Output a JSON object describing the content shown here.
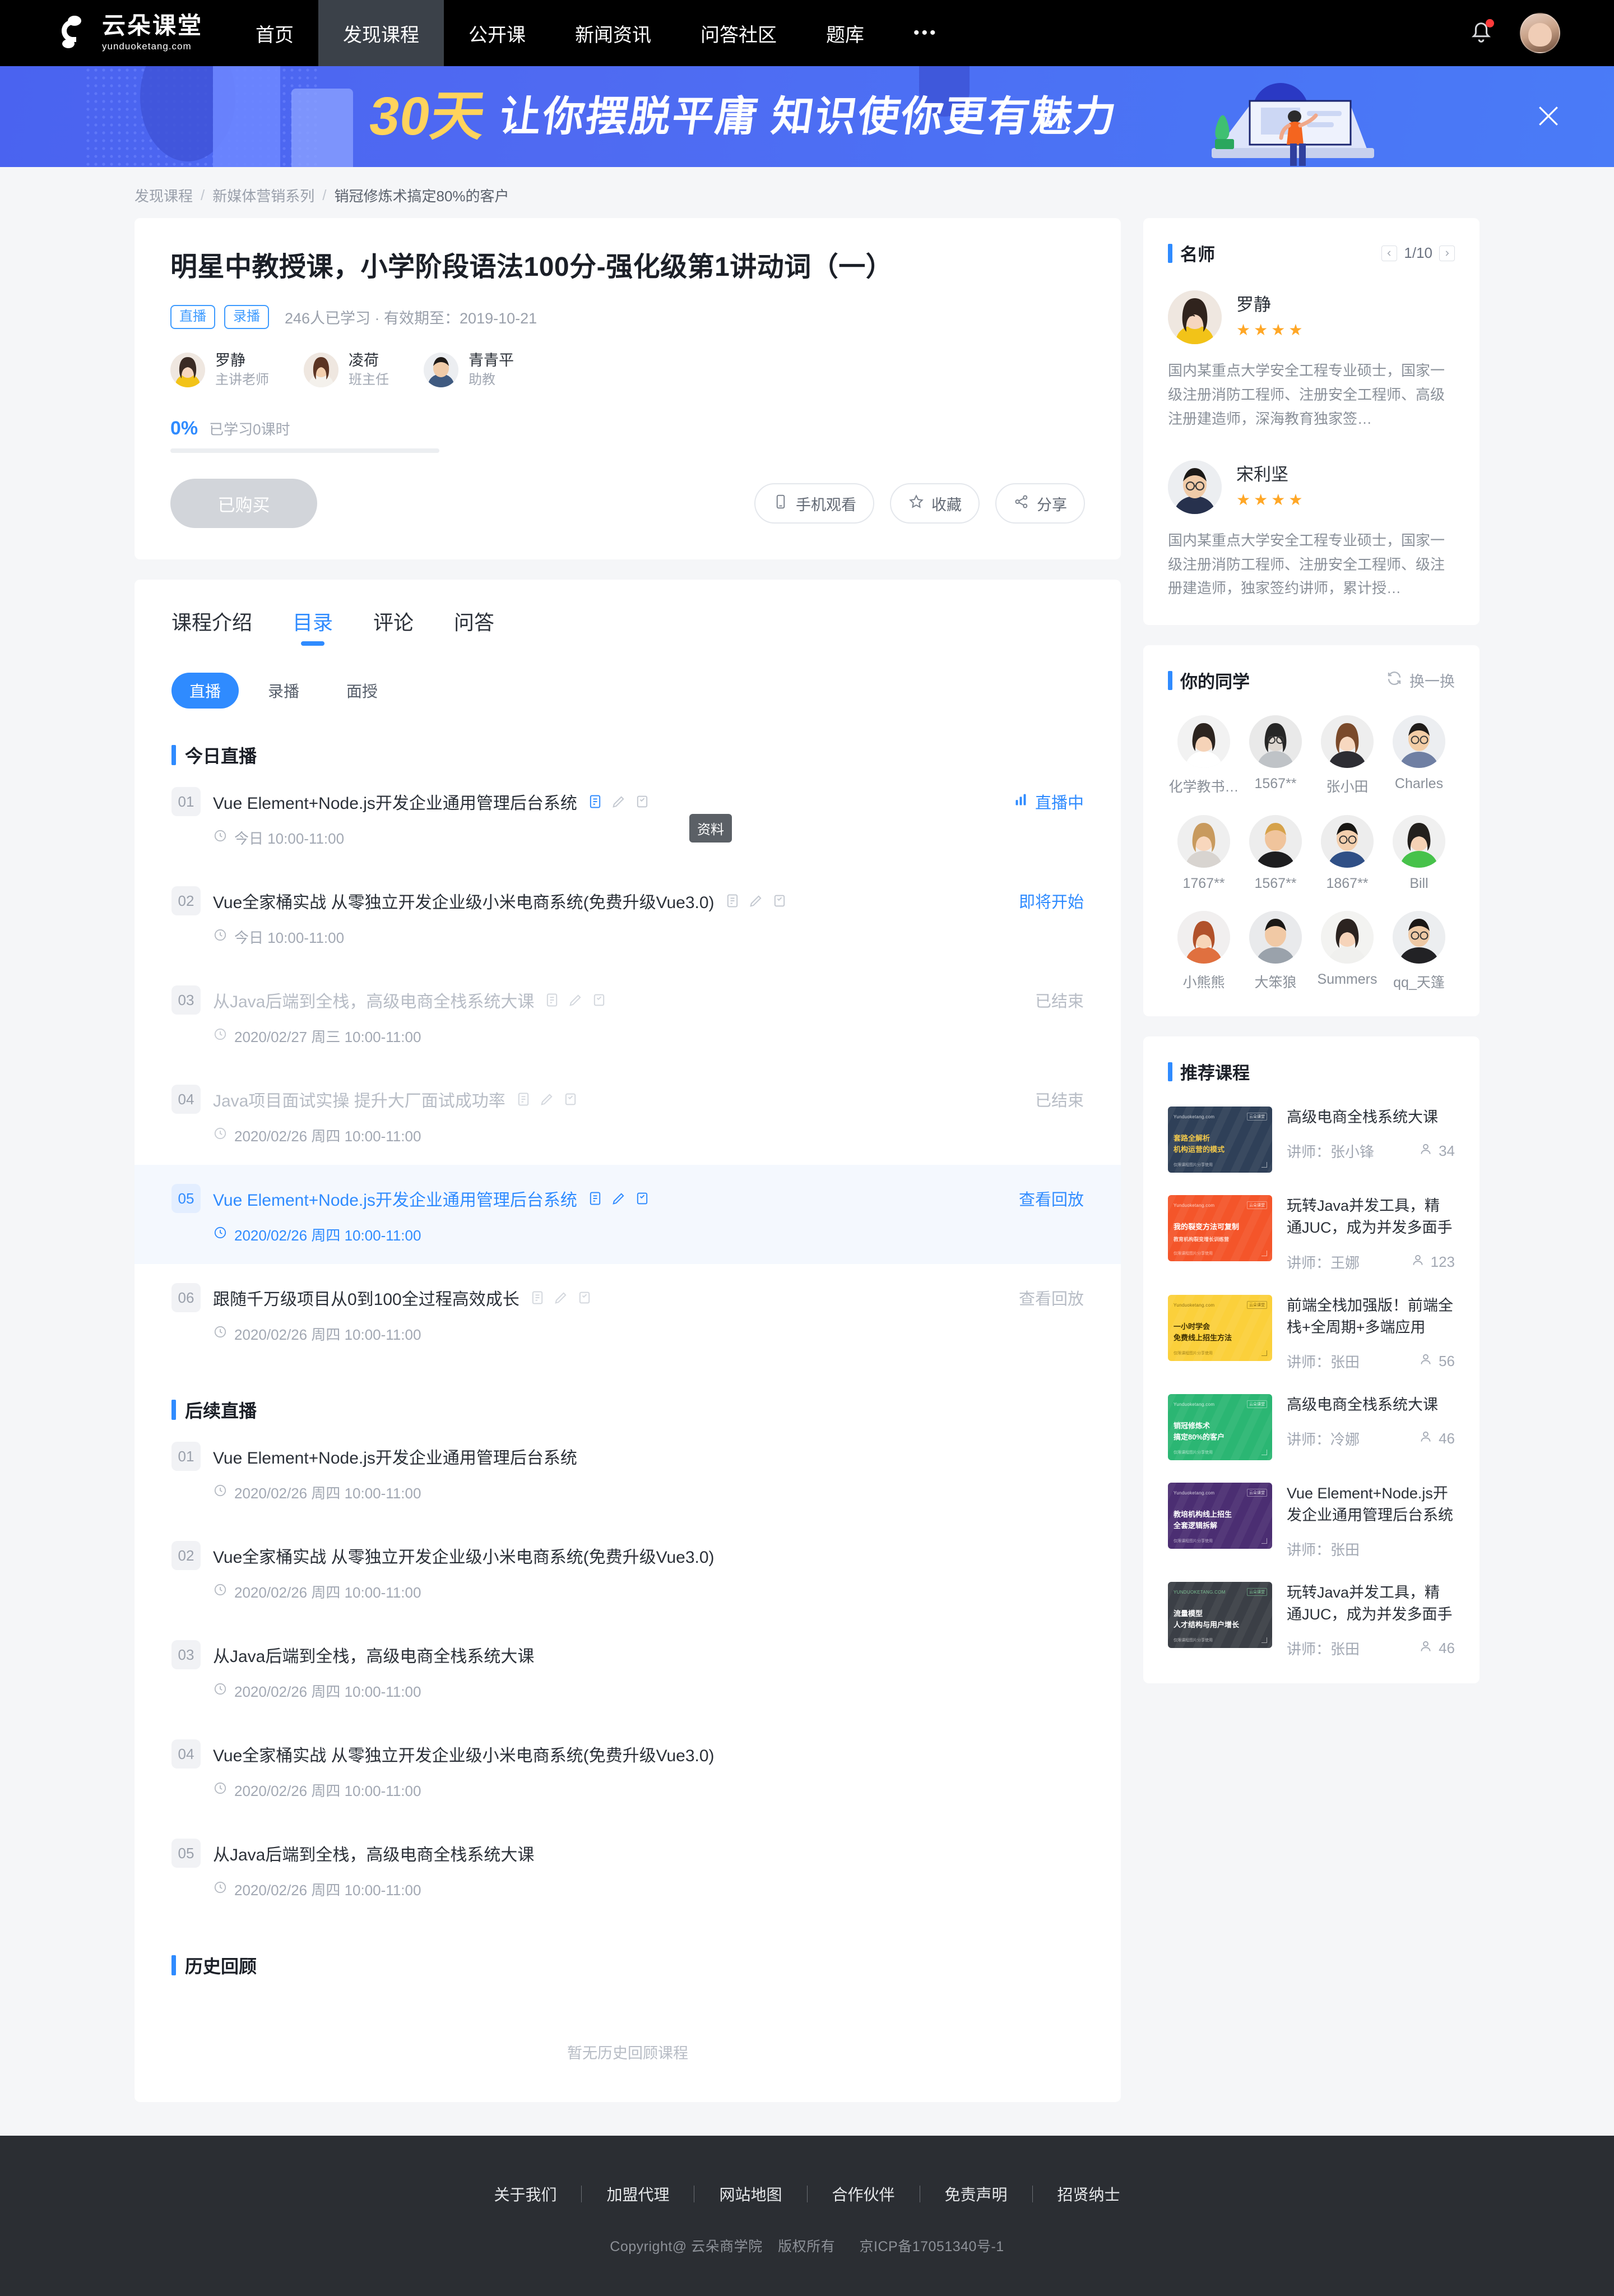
{
  "nav": {
    "logo_title": "云朵课堂",
    "logo_sub": "yunduoketang.com",
    "items": [
      {
        "label": "首页",
        "active": false
      },
      {
        "label": "发现课程",
        "active": true
      },
      {
        "label": "公开课",
        "active": false
      },
      {
        "label": "新闻资讯",
        "active": false
      },
      {
        "label": "问答社区",
        "active": false
      },
      {
        "label": "题库",
        "active": false
      }
    ],
    "more": "•••"
  },
  "banner": {
    "highlight": "30天",
    "headline": "让你摆脱平庸 知识使你更有魅力"
  },
  "breadcrumb": [
    "发现课程",
    "新媒体营销系列",
    "销冠修炼术搞定80%的客户"
  ],
  "course": {
    "title": "明星中教授课，小学阶段语法100分-强化级第1讲动词（一）",
    "tags": [
      "直播",
      "录播"
    ],
    "meta": "246人已学习 · 有效期至：2019-10-21",
    "teachers": [
      {
        "name": "罗静",
        "role": "主讲老师"
      },
      {
        "name": "凌荷",
        "role": "班主任"
      },
      {
        "name": "青青平",
        "role": "助教"
      }
    ],
    "progress_pct": "0%",
    "progress_label": "已学习0课时",
    "progress_value": 0,
    "buy_button": "已购买",
    "actions": [
      {
        "label": "手机观看",
        "icon": "phone-icon"
      },
      {
        "label": "收藏",
        "icon": "star-icon"
      },
      {
        "label": "分享",
        "icon": "share-icon"
      }
    ]
  },
  "catalog": {
    "tabs": [
      {
        "label": "课程介绍",
        "active": false
      },
      {
        "label": "目录",
        "active": true
      },
      {
        "label": "评论",
        "active": false
      },
      {
        "label": "问答",
        "active": false
      }
    ],
    "chips": [
      {
        "label": "直播",
        "active": true
      },
      {
        "label": "录播",
        "active": false
      },
      {
        "label": "面授",
        "active": false
      }
    ],
    "tooltip": "资料",
    "sections": [
      {
        "title": "今日直播",
        "show_icons": true,
        "lessons": [
          {
            "num": "01",
            "title": "Vue Element+Node.js开发企业通用管理后台系统",
            "time": "今日 10:00-11:00",
            "status": "直播中",
            "state": "live"
          },
          {
            "num": "02",
            "title": "Vue全家桶实战 从零独立开发企业级小米电商系统(免费升级Vue3.0)",
            "time": "今日 10:00-11:00",
            "status": "即将开始",
            "state": "soon"
          },
          {
            "num": "03",
            "title": "从Java后端到全栈，高级电商全栈系统大课",
            "time": "2020/02/27 周三 10:00-11:00",
            "status": "已结束",
            "state": "ended"
          },
          {
            "num": "04",
            "title": "Java项目面试实操 提升大厂面试成功率",
            "time": "2020/02/26 周四 10:00-11:00",
            "status": "已结束",
            "state": "ended"
          },
          {
            "num": "05",
            "title": "Vue Element+Node.js开发企业通用管理后台系统",
            "time": "2020/02/26 周四 10:00-11:00",
            "status": "查看回放",
            "state": "highlight"
          },
          {
            "num": "06",
            "title": "跟随千万级项目从0到100全过程高效成长",
            "time": "2020/02/26 周四 10:00-11:00",
            "status": "查看回放",
            "state": "replay-muted"
          }
        ]
      },
      {
        "title": "后续直播",
        "show_icons": false,
        "lessons": [
          {
            "num": "01",
            "title": "Vue Element+Node.js开发企业通用管理后台系统",
            "time": "2020/02/26 周四 10:00-11:00",
            "status": "",
            "state": "plain"
          },
          {
            "num": "02",
            "title": "Vue全家桶实战 从零独立开发企业级小米电商系统(免费升级Vue3.0)",
            "time": "2020/02/26 周四 10:00-11:00",
            "status": "",
            "state": "plain"
          },
          {
            "num": "03",
            "title": "从Java后端到全栈，高级电商全栈系统大课",
            "time": "2020/02/26 周四 10:00-11:00",
            "status": "",
            "state": "plain"
          },
          {
            "num": "04",
            "title": "Vue全家桶实战 从零独立开发企业级小米电商系统(免费升级Vue3.0)",
            "time": "2020/02/26 周四 10:00-11:00",
            "status": "",
            "state": "plain"
          },
          {
            "num": "05",
            "title": "从Java后端到全栈，高级电商全栈系统大课",
            "time": "2020/02/26 周四 10:00-11:00",
            "status": "",
            "state": "plain"
          }
        ]
      }
    ],
    "history_title": "历史回顾",
    "history_empty": "暂无历史回顾课程"
  },
  "sidebar": {
    "teachers_panel": {
      "title": "名师",
      "page": "1/10",
      "items": [
        {
          "name": "罗静",
          "stars": 4,
          "desc": "国内某重点大学安全工程专业硕士，国家一级注册消防工程师、注册安全工程师、高级注册建造师，深海教育独家签…",
          "avatar_colors": {
            "bg": "#efe7e0",
            "hair": "#3a2b24",
            "skin": "#f6d6bf",
            "cloth": "#f2c318"
          }
        },
        {
          "name": "宋利坚",
          "stars": 4,
          "desc": "国内某重点大学安全工程专业硕士，国家一级注册消防工程师、注册安全工程师、级注册建造师，独家签约讲师，累计授…",
          "avatar_colors": {
            "bg": "#eceef1",
            "hair": "#1d1b19",
            "skin": "#f0cba8",
            "cloth": "#27314d"
          }
        }
      ]
    },
    "classmates_panel": {
      "title": "你的同学",
      "refresh_label": "换一换",
      "items": [
        {
          "name": "化学教书…",
          "cloth": "#f2f2f2",
          "hair": "#2c241f",
          "skin": "#f5d3b8"
        },
        {
          "name": "1567**",
          "cloth": "#bfc3c7",
          "hair": "#262626",
          "skin": "#d9d3cd"
        },
        {
          "name": "张小田",
          "cloth": "#2d2d33",
          "hair": "#7a4a2b",
          "skin": "#f7d8c0"
        },
        {
          "name": "Charles",
          "cloth": "#6f7fa3",
          "hair": "#1f1c1a",
          "skin": "#f3cda6"
        },
        {
          "name": "1767**",
          "cloth": "#d8d4d0",
          "hair": "#c89a5e",
          "skin": "#f8d7bd"
        },
        {
          "name": "1567**",
          "cloth": "#1d1d1f",
          "hair": "#d6a24a",
          "skin": "#f0c49c"
        },
        {
          "name": "1867**",
          "cloth": "#2f4f86",
          "hair": "#181614",
          "skin": "#f3cfae"
        },
        {
          "name": "Bill",
          "cloth": "#47c24a",
          "hair": "#23201d",
          "skin": "#f5d2b5"
        },
        {
          "name": "小熊熊",
          "cloth": "#e0703f",
          "hair": "#b1512a",
          "skin": "#f7d5b7"
        },
        {
          "name": "大笨狼",
          "cloth": "#9aa2ab",
          "hair": "#1b1916",
          "skin": "#f1c9a5"
        },
        {
          "name": "Summers",
          "cloth": "#f0f0ee",
          "hair": "#2b2320",
          "skin": "#f6d4ba"
        },
        {
          "name": "qq_天篷",
          "cloth": "#222225",
          "hair": "#1a1715",
          "skin": "#eec9a5"
        }
      ]
    },
    "recommend_panel": {
      "title": "推荐课程",
      "items": [
        {
          "title": "高级电商全栈系统大课",
          "teacher_label": "讲师：张小锋",
          "count": "34",
          "show_count": true,
          "thumb": {
            "bg": "#2f4058",
            "l1": "套路全解析",
            "l2": "机构运营的模式",
            "accent": "#f1c84b",
            "brand": "Yunduoketang.com",
            "badge": "云朵课堂",
            "foot": "仅限课程图片分享使用"
          }
        },
        {
          "title": "玩转Java并发工具，精通JUC，成为并发多面手",
          "teacher_label": "讲师：王娜",
          "count": "123",
          "show_count": true,
          "thumb": {
            "bg": "#f4552a",
            "l1": "我的裂变方法可复制",
            "l2": "教育机构裂变增长训练营",
            "accent": "#ffffff",
            "brand": "Yunduoketang.com",
            "badge": "云朵课堂",
            "foot": "仅限课程图片分享使用"
          }
        },
        {
          "title": "前端全栈加强版！前端全栈+全周期+多端应用",
          "teacher_label": "讲师：张田",
          "count": "56",
          "show_count": true,
          "thumb": {
            "bg": "#fbd03b",
            "l1": "一小时学会",
            "l2": "免费线上招生方法",
            "accent": "#5c4300",
            "brand": "Yunduoketang.com",
            "badge": "云朵课堂",
            "foot": "仅限课程图片分享使用"
          }
        },
        {
          "title": "高级电商全栈系统大课",
          "teacher_label": "讲师：冷娜",
          "count": "46",
          "show_count": true,
          "thumb": {
            "bg": "#2bb673",
            "l1": "销冠修炼术",
            "l2": "搞定80%的客户",
            "accent": "#ffffff",
            "brand": "Yunduoketang.com",
            "badge": "云朵课堂",
            "foot": "仅限课程图片分享使用"
          }
        },
        {
          "title": "Vue Element+Node.js开发企业通用管理后台系统",
          "teacher_label": "讲师：张田",
          "count": "",
          "show_count": false,
          "thumb": {
            "bg": "#4b2e72",
            "l1": "教培机构线上招生",
            "l2": "全套逻辑拆解",
            "accent": "#ffffff",
            "brand": "Yunduoketang.com",
            "badge": "云朵课堂",
            "foot": "仅限课程图片分享使用"
          }
        },
        {
          "title": "玩转Java并发工具，精通JUC，成为并发多面手",
          "teacher_label": "讲师：张田",
          "count": "46",
          "show_count": true,
          "thumb": {
            "bg": "#3b3f46",
            "l1": "流量模型",
            "l2": "人才结构与用户增长",
            "accent": "#8de3a8",
            "brand": "YUNDUOKETANG.COM",
            "badge": "云朵课堂",
            "foot": "仅限课程图片分享使用"
          }
        }
      ]
    }
  },
  "footer": {
    "links": [
      "关于我们",
      "加盟代理",
      "网站地图",
      "合作伙伴",
      "免责声明",
      "招贤纳士"
    ],
    "copyright_1": "Copyright@ 云朵商学院",
    "copyright_2": "版权所有",
    "icp": "京ICP备17051340号-1"
  },
  "colors": {
    "accent": "#2f8bff",
    "nav_bg": "#000000",
    "banner_blue": "#4a63f0",
    "banner_yellow": "#ffd35c",
    "star": "#ffa726"
  }
}
